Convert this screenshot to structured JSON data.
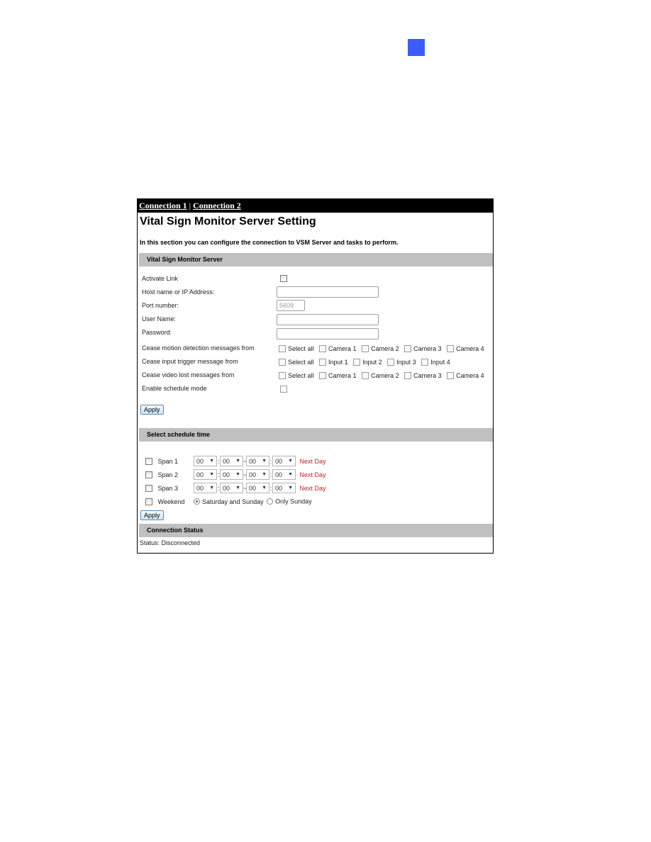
{
  "page_marker_color": "#3b5cff",
  "tabs": [
    {
      "label": "Connection 1"
    },
    {
      "label": "Connection 2"
    }
  ],
  "tab_separator": "|",
  "title": "Vital Sign Monitor Server Setting",
  "intro": "In this section you can configure the connection to VSM Server and tasks to perform.",
  "server_section": {
    "heading": "Vital Sign Monitor Server",
    "activate_link_label": "Activate Link",
    "host_label": "Host name or IP Address:",
    "host_value": "",
    "port_label": "Port number:",
    "port_value": "5609",
    "username_label": "User Name:",
    "username_value": "",
    "password_label": "Password:",
    "password_value": "",
    "motion_label": "Cease motion detection messages from",
    "motion_options": [
      "Select all",
      "Camera 1",
      "Camera 2",
      "Camera 3",
      "Camera 4"
    ],
    "input_label": "Cease input trigger message from",
    "input_options": [
      "Select all",
      "Input 1",
      "Input 2",
      "Input 3",
      "Input 4"
    ],
    "videolost_label": "Cease video lost messages from",
    "videolost_options": [
      "Select all",
      "Camera 1",
      "Camera 2",
      "Camera 3",
      "Camera 4"
    ],
    "schedule_mode_label": "Enable schedule mode",
    "apply_label": "Apply"
  },
  "schedule_section": {
    "heading": "Select schedule time",
    "spans": [
      {
        "label": "Span 1",
        "start_h": "00",
        "start_m": "00",
        "end_h": "00",
        "end_m": "00",
        "next_day": "Next Day"
      },
      {
        "label": "Span 2",
        "start_h": "00",
        "start_m": "00",
        "end_h": "00",
        "end_m": "00",
        "next_day": "Next Day"
      },
      {
        "label": "Span 3",
        "start_h": "00",
        "start_m": "00",
        "end_h": "00",
        "end_m": "00",
        "next_day": "Next Day"
      }
    ],
    "range_sep": "~",
    "time_sep": ":",
    "weekend_label": "Weekend",
    "weekend_options": [
      {
        "label": "Saturday and Sunday",
        "selected": true
      },
      {
        "label": "Only Sunday",
        "selected": false
      }
    ],
    "apply_label": "Apply"
  },
  "status_section": {
    "heading": "Connection Status",
    "status_text": "Status: Disconnected"
  }
}
